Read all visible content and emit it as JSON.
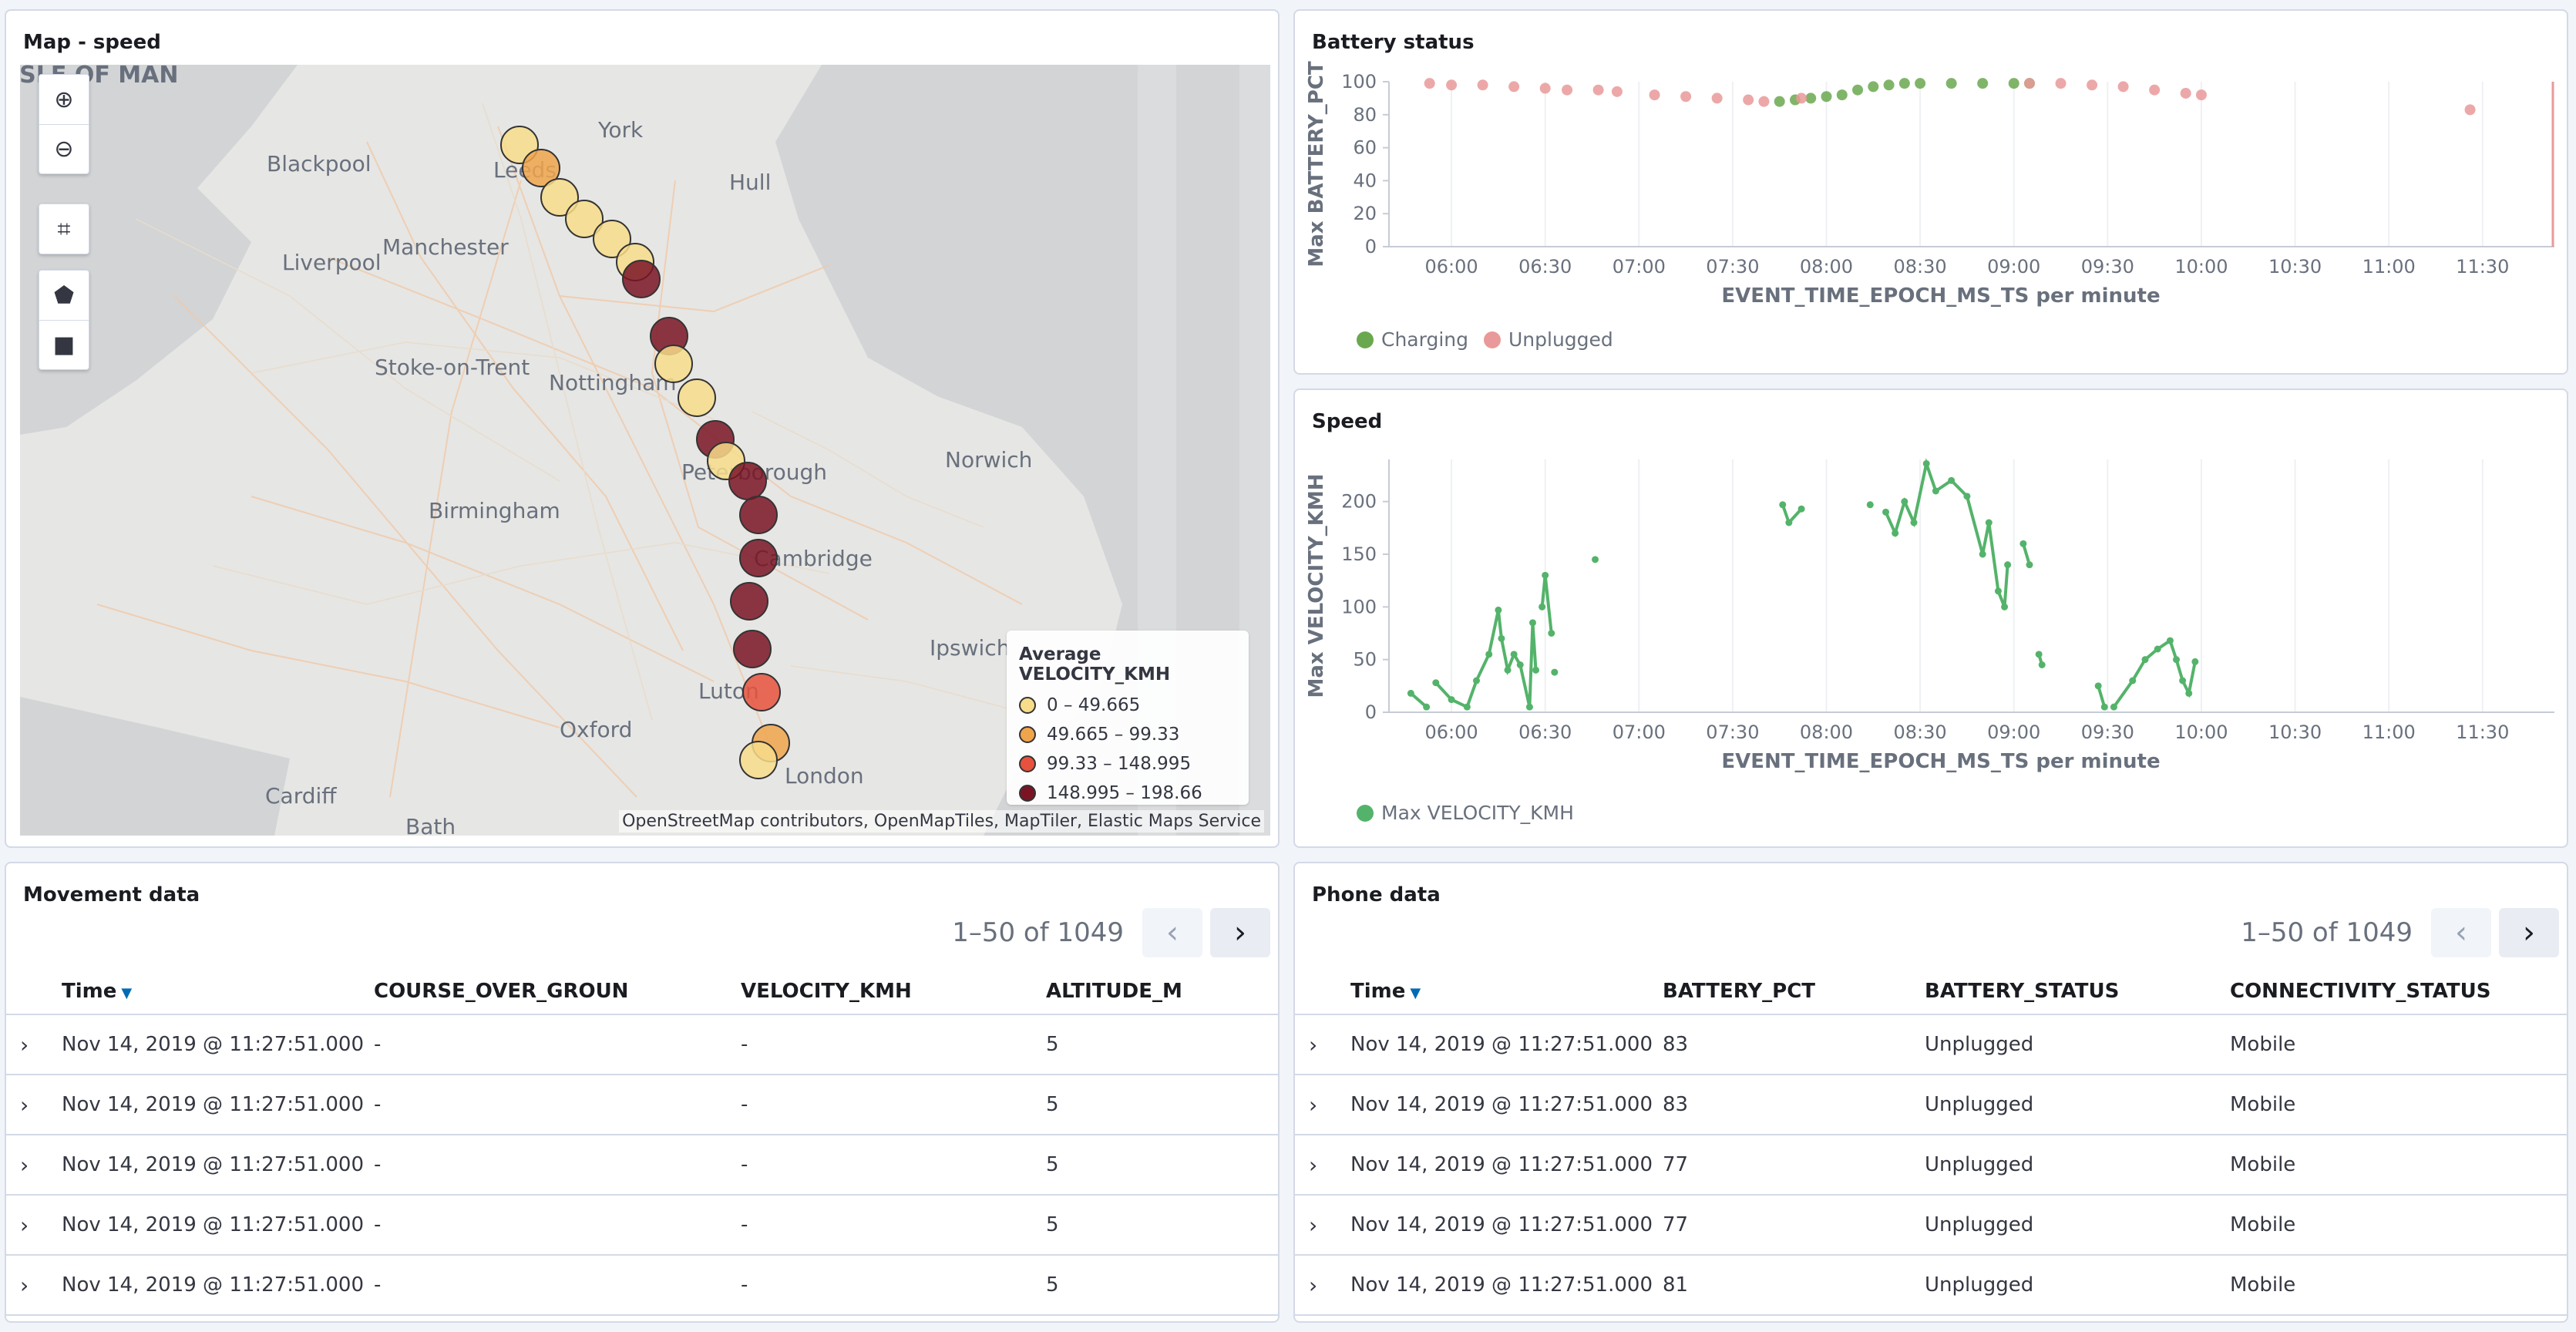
{
  "map_panel": {
    "title": "Map - speed",
    "attribution": "OpenStreetMap contributors, OpenMapTiles, MapTiler, Elastic Maps Service",
    "cities": [
      "ISLE OF MAN",
      "York",
      "Blackpool",
      "Leeds",
      "Hull",
      "Manchester",
      "Liverpool",
      "Stoke-on-Trent",
      "Nottingham",
      "Peterborough",
      "Norwich",
      "Birmingham",
      "Cambridge",
      "Ipswich",
      "Luton",
      "Oxford",
      "London",
      "Cardiff",
      "Bath"
    ],
    "legend": {
      "title": "Average VELOCITY_KMH",
      "items": [
        {
          "label": "0 – 49.665",
          "color": "#f7dc8a"
        },
        {
          "label": "49.665 – 99.33",
          "color": "#f0a44c"
        },
        {
          "label": "99.33 – 148.995",
          "color": "#e8513d"
        },
        {
          "label": "148.995 – 198.66",
          "color": "#7a1424"
        }
      ]
    },
    "controls": [
      "zoom-in-icon",
      "zoom-out-icon",
      "crop-icon",
      "polygon-icon",
      "square-icon"
    ],
    "points": [
      {
        "place": "York area",
        "bucket": 0
      },
      {
        "place": "Leeds",
        "bucket": 1
      },
      {
        "place": "",
        "bucket": 0
      },
      {
        "place": "",
        "bucket": 0
      },
      {
        "place": "",
        "bucket": 0
      },
      {
        "place": "",
        "bucket": 0
      },
      {
        "place": "",
        "bucket": 3
      },
      {
        "place": "",
        "bucket": 3
      },
      {
        "place": "",
        "bucket": 0
      },
      {
        "place": "Nottingham",
        "bucket": 0
      },
      {
        "place": "",
        "bucket": 3
      },
      {
        "place": "",
        "bucket": 0
      },
      {
        "place": "Peterborough",
        "bucket": 3
      },
      {
        "place": "",
        "bucket": 3
      },
      {
        "place": "",
        "bucket": 3
      },
      {
        "place": "Cambridge",
        "bucket": 3
      },
      {
        "place": "",
        "bucket": 3
      },
      {
        "place": "Luton",
        "bucket": 2
      },
      {
        "place": "London",
        "bucket": 1
      },
      {
        "place": "London",
        "bucket": 0
      }
    ]
  },
  "battery_panel": {
    "title": "Battery status",
    "chart_data": {
      "type": "scatter",
      "ylabel": "Max BATTERY_PCT",
      "xlabel": "EVENT_TIME_EPOCH_MS_TS per minute",
      "ylim": [
        0,
        100
      ],
      "yticks": [
        "0",
        "20",
        "40",
        "60",
        "80",
        "100"
      ],
      "xticks": [
        "06:00",
        "06:30",
        "07:00",
        "07:30",
        "08:00",
        "08:30",
        "09:00",
        "09:30",
        "10:00",
        "10:30",
        "11:00",
        "11:30"
      ],
      "xrange": [
        "05:40",
        "11:53"
      ],
      "series": [
        {
          "name": "Charging",
          "color": "#6aa84f",
          "points": [
            [
              "07:45",
              88
            ],
            [
              "07:50",
              89
            ],
            [
              "07:55",
              90
            ],
            [
              "08:00",
              91
            ],
            [
              "08:05",
              92
            ],
            [
              "08:10",
              95
            ],
            [
              "08:15",
              97
            ],
            [
              "08:20",
              98
            ],
            [
              "08:25",
              99
            ],
            [
              "08:30",
              99
            ],
            [
              "08:40",
              99
            ],
            [
              "08:50",
              99
            ],
            [
              "09:00",
              99
            ],
            [
              "09:05",
              99
            ]
          ]
        },
        {
          "name": "Unplugged",
          "color": "#e99999",
          "points": [
            [
              "05:53",
              99
            ],
            [
              "06:00",
              98
            ],
            [
              "06:10",
              98
            ],
            [
              "06:20",
              97
            ],
            [
              "06:30",
              96
            ],
            [
              "06:37",
              95
            ],
            [
              "06:47",
              95
            ],
            [
              "06:53",
              94
            ],
            [
              "07:05",
              92
            ],
            [
              "07:15",
              91
            ],
            [
              "07:25",
              90
            ],
            [
              "07:35",
              89
            ],
            [
              "07:40",
              88
            ],
            [
              "07:52",
              90
            ],
            [
              "09:05",
              99
            ],
            [
              "09:15",
              99
            ],
            [
              "09:25",
              98
            ],
            [
              "09:35",
              97
            ],
            [
              "09:45",
              95
            ],
            [
              "09:55",
              93
            ],
            [
              "10:00",
              92
            ],
            [
              "11:26",
              83
            ]
          ]
        }
      ]
    }
  },
  "speed_panel": {
    "title": "Speed",
    "chart_data": {
      "type": "line",
      "ylabel": "Max VELOCITY_KMH",
      "xlabel": "EVENT_TIME_EPOCH_MS_TS per minute",
      "ylim": [
        0,
        240
      ],
      "yticks": [
        "0",
        "50",
        "100",
        "150",
        "200"
      ],
      "xticks": [
        "06:00",
        "06:30",
        "07:00",
        "07:30",
        "08:00",
        "08:30",
        "09:00",
        "09:30",
        "10:00",
        "10:30",
        "11:00",
        "11:30"
      ],
      "xrange": [
        "05:40",
        "11:53"
      ],
      "series": [
        {
          "name": "Max VELOCITY_KMH",
          "color": "#54b36a",
          "segments": [
            [
              [
                "05:47",
                18
              ],
              [
                "05:52",
                5
              ]
            ],
            [
              [
                "05:55",
                28
              ],
              [
                "06:00",
                12
              ],
              [
                "06:05",
                5
              ],
              [
                "06:08",
                30
              ],
              [
                "06:12",
                55
              ],
              [
                "06:15",
                97
              ],
              [
                "06:16",
                70
              ],
              [
                "06:18",
                40
              ],
              [
                "06:20",
                55
              ],
              [
                "06:22",
                45
              ],
              [
                "06:25",
                5
              ],
              [
                "06:26",
                85
              ],
              [
                "06:27",
                40
              ]
            ],
            [
              [
                "06:29",
                100
              ],
              [
                "06:30",
                130
              ],
              [
                "06:32",
                75
              ]
            ],
            [
              [
                "06:33",
                38
              ]
            ],
            [
              [
                "06:46",
                145
              ]
            ],
            [
              [
                "07:46",
                197
              ],
              [
                "07:48",
                180
              ],
              [
                "07:52",
                193
              ]
            ],
            [
              [
                "08:14",
                197
              ]
            ],
            [
              [
                "08:19",
                190
              ],
              [
                "08:22",
                170
              ],
              [
                "08:25",
                200
              ],
              [
                "08:28",
                180
              ],
              [
                "08:32",
                236
              ],
              [
                "08:35",
                210
              ],
              [
                "08:40",
                220
              ],
              [
                "08:45",
                205
              ],
              [
                "08:50",
                150
              ],
              [
                "08:52",
                180
              ],
              [
                "08:55",
                115
              ],
              [
                "08:57",
                100
              ],
              [
                "08:58",
                140
              ]
            ],
            [
              [
                "09:03",
                160
              ],
              [
                "09:05",
                140
              ]
            ],
            [
              [
                "09:08",
                55
              ],
              [
                "09:09",
                45
              ]
            ],
            [
              [
                "09:27",
                25
              ],
              [
                "09:29",
                5
              ]
            ],
            [
              [
                "09:32",
                5
              ],
              [
                "09:38",
                30
              ],
              [
                "09:42",
                50
              ],
              [
                "09:46",
                60
              ],
              [
                "09:50",
                68
              ],
              [
                "09:52",
                50
              ],
              [
                "09:54",
                30
              ],
              [
                "09:56",
                18
              ],
              [
                "09:58",
                48
              ]
            ]
          ]
        }
      ]
    }
  },
  "movement_panel": {
    "title": "Movement data",
    "pager_text": "1–50 of 1049",
    "columns": [
      "Time",
      "COURSE_OVER_GROUN",
      "VELOCITY_KMH",
      "ALTITUDE_M"
    ],
    "rows": [
      [
        "Nov 14, 2019 @ 11:27:51.000",
        "-",
        "-",
        "5"
      ],
      [
        "Nov 14, 2019 @ 11:27:51.000",
        "-",
        "-",
        "5"
      ],
      [
        "Nov 14, 2019 @ 11:27:51.000",
        "-",
        "-",
        "5"
      ],
      [
        "Nov 14, 2019 @ 11:27:51.000",
        "-",
        "-",
        "5"
      ],
      [
        "Nov 14, 2019 @ 11:27:51.000",
        "-",
        "-",
        "5"
      ]
    ]
  },
  "phone_panel": {
    "title": "Phone data",
    "pager_text": "1–50 of 1049",
    "columns": [
      "Time",
      "BATTERY_PCT",
      "BATTERY_STATUS",
      "CONNECTIVITY_STATUS"
    ],
    "rows": [
      [
        "Nov 14, 2019 @ 11:27:51.000",
        "83",
        "Unplugged",
        "Mobile"
      ],
      [
        "Nov 14, 2019 @ 11:27:51.000",
        "83",
        "Unplugged",
        "Mobile"
      ],
      [
        "Nov 14, 2019 @ 11:27:51.000",
        "77",
        "Unplugged",
        "Mobile"
      ],
      [
        "Nov 14, 2019 @ 11:27:51.000",
        "77",
        "Unplugged",
        "Mobile"
      ],
      [
        "Nov 14, 2019 @ 11:27:51.000",
        "81",
        "Unplugged",
        "Mobile"
      ]
    ]
  }
}
